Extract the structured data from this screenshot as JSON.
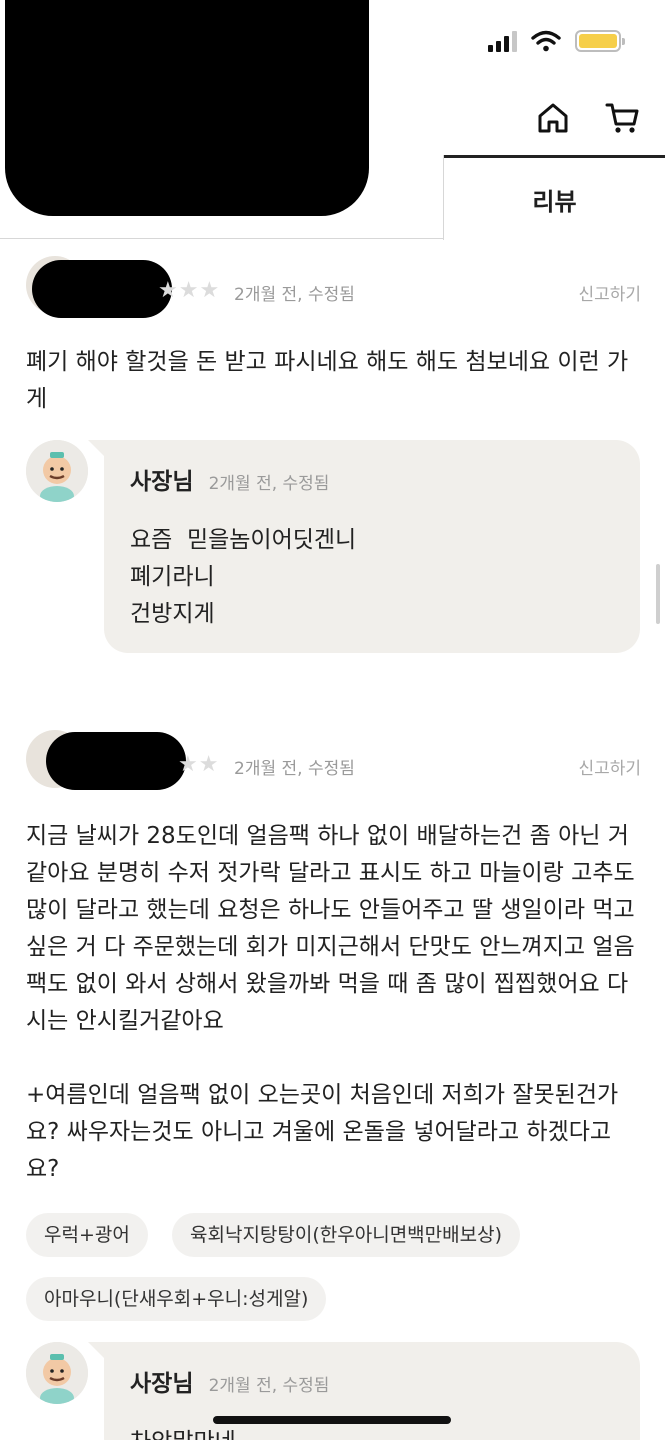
{
  "header": {
    "home_icon": "home-icon",
    "cart_icon": "cart-icon",
    "tab_label": "리뷰"
  },
  "reviews": [
    {
      "rating": 0,
      "stars": "★★★",
      "meta": "2개월 전, 수정됨",
      "report": "신고하기",
      "body": "폐기 해야 할것을 돈 받고 파시네요 해도 해도 첨보네요 이런 가게",
      "reply": {
        "owner": "사장님",
        "meta": "2개월 전, 수정됨",
        "lines": [
          "요즘  믿을놈이어딧겐니",
          "폐기라니",
          "건방지게"
        ]
      }
    },
    {
      "stars": "★★",
      "meta": "2개월 전, 수정됨",
      "report": "신고하기",
      "body_p1": "지금 날씨가 28도인데 얼음팩 하나 없이 배달하는건 좀 아닌 거 같아요 분명히 수저 젓가락 달라고 표시도 하고 마늘이랑 고추도 많이 달라고 했는데 요청은 하나도 안들어주고 딸 생일이라 먹고싶은 거 다 주문했는데 회가 미지근해서 단맛도 안느껴지고 얼음팩도 없이 와서 상해서 왔을까봐 먹을 때 좀 많이 찝찝했어요 다시는 안시킬거같아요",
      "body_p2": "+여름인데 얼음팩 없이 오는곳이 처음인데 저희가 잘못된건가요? 싸우자는것도 아니고 겨울에 온돌을 넣어달라고 하겠다고요?",
      "chips": [
        "우럭+광어",
        "육회낙지탕탕이(한우아니면백만배보상)",
        "아마우니(단새우회+우니:성게알)"
      ],
      "reply": {
        "owner": "사장님",
        "meta": "2개월 전, 수정됨",
        "first_line": "차암말만네"
      }
    }
  ]
}
